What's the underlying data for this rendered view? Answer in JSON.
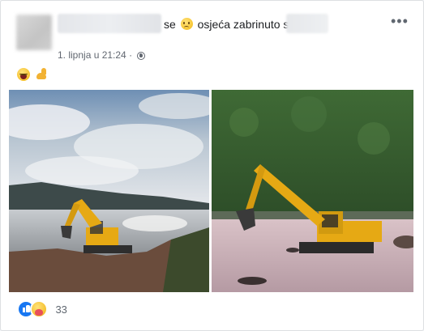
{
  "post": {
    "status_word": "se",
    "feeling_text": "osjeća zabrinuto s",
    "feeling_emoji": "worried-face-icon",
    "timestamp": "1. lipnja u 21:24 ·",
    "privacy_icon": "globe-icon",
    "more_label": "•••",
    "content_emojis": [
      "laughing-face-icon",
      "flexed-biceps-icon"
    ]
  },
  "photos": [
    {
      "name": "excavator-on-shore-photo",
      "alt": "Excavator near the sea at sunset"
    },
    {
      "name": "excavator-in-water-photo",
      "alt": "Excavator standing in shallow water"
    }
  ],
  "reactions": {
    "icons": [
      "like-icon",
      "care-icon"
    ],
    "count": "33",
    "like_color": "#1877f2"
  }
}
